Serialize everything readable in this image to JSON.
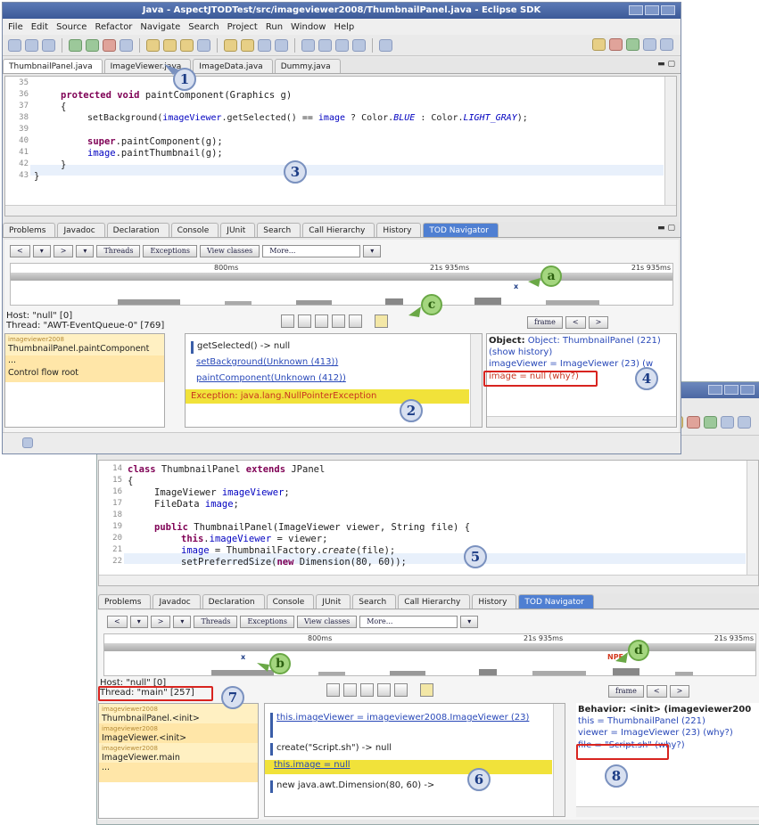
{
  "window1": {
    "title": "Java - AspectJTODTest/src/imageviewer2008/ThumbnailPanel.java - Eclipse SDK",
    "menu": [
      "File",
      "Edit",
      "Source",
      "Refactor",
      "Navigate",
      "Search",
      "Project",
      "Run",
      "Window",
      "Help"
    ],
    "editor_tabs": [
      "ThumbnailPanel.java",
      "ImageViewer.java",
      "ImageData.java",
      "Dummy.java"
    ],
    "code_lines": [
      {
        "n": "35",
        "t": ""
      },
      {
        "n": "36",
        "t": "protected void paintComponent(Graphics g)"
      },
      {
        "n": "37",
        "t": "{"
      },
      {
        "n": "38",
        "t": "setBackground(imageViewer.getSelected() == image ? Color.BLUE : Color.LIGHT_GRAY);"
      },
      {
        "n": "39",
        "t": ""
      },
      {
        "n": "40",
        "t": "super.paintComponent(g);"
      },
      {
        "n": "41",
        "t": "image.paintThumbnail(g);"
      },
      {
        "n": "42",
        "t": "}"
      },
      {
        "n": "43",
        "t": "}"
      }
    ],
    "view_tabs": [
      "Problems",
      "Javadoc",
      "Declaration",
      "Console",
      "JUnit",
      "Search",
      "Call Hierarchy",
      "History",
      "TOD Navigator"
    ],
    "nav_buttons": [
      "Threads",
      "Exceptions",
      "View classes",
      "More..."
    ],
    "timeline_labels": [
      "800ms",
      "21s 935ms",
      "21s 935ms"
    ],
    "host": "Host: \"null\" [0]",
    "thread": "Thread: \"AWT-EventQueue-0\" [769]",
    "stack": [
      {
        "pkg": "imageviewer2008",
        "label": "ThumbnailPanel.paintComponent"
      },
      {
        "pkg": "",
        "label": "..."
      },
      {
        "pkg": "",
        "label": "Control flow root"
      }
    ],
    "events": [
      "getSelected() -> null",
      "setBackground(Unknown (413))",
      "paintComponent(Unknown (412))",
      "Exception: java.lang.NullPointerException"
    ],
    "frame_label": "frame",
    "object": {
      "header": "Object: ThumbnailPanel (221)",
      "show_history": "(show history)",
      "row1": "imageViewer = ImageViewer (23) (w",
      "row2": "image = null (why?)"
    }
  },
  "window2": {
    "code_lines": [
      {
        "n": "14",
        "t": "class ThumbnailPanel extends JPanel"
      },
      {
        "n": "15",
        "t": "{"
      },
      {
        "n": "16",
        "t": "ImageViewer imageViewer;"
      },
      {
        "n": "17",
        "t": "FileData image;"
      },
      {
        "n": "18",
        "t": ""
      },
      {
        "n": "19",
        "t": "public ThumbnailPanel(ImageViewer viewer, String file) {"
      },
      {
        "n": "20",
        "t": "this.imageViewer = viewer;"
      },
      {
        "n": "21",
        "t": "image = ThumbnailFactory.create(file);"
      },
      {
        "n": "22",
        "t": "setPreferredSize(new Dimension(80, 60));"
      }
    ],
    "view_tabs": [
      "Problems",
      "Javadoc",
      "Declaration",
      "Console",
      "JUnit",
      "Search",
      "Call Hierarchy",
      "History",
      "TOD Navigator"
    ],
    "nav_buttons": [
      "Threads",
      "Exceptions",
      "View classes",
      "More..."
    ],
    "timeline_labels": [
      "800ms",
      "21s 935ms",
      "21s 935ms"
    ],
    "npe_label": "NPE",
    "host": "Host: \"null\" [0]",
    "thread": "Thread: \"main\" [257]",
    "stack": [
      {
        "pkg": "imageviewer2008",
        "label": "ThumbnailPanel.<init>"
      },
      {
        "pkg": "imageviewer2008",
        "label": "ImageViewer.<init>"
      },
      {
        "pkg": "imageviewer2008",
        "label": "ImageViewer.main"
      },
      {
        "pkg": "",
        "label": "..."
      }
    ],
    "events": [
      "this.imageViewer = imageviewer2008.ImageViewer (23)",
      "create(\"Script.sh\") -> null",
      "this.image = null",
      "new java.awt.Dimension(80, 60) ->"
    ],
    "frame_label": "frame",
    "behavior": {
      "header": "Behavior: <init> (imageviewer200",
      "row1": "this = ThumbnailPanel (221)",
      "row2": "viewer = ImageViewer (23) (why?)",
      "row3": "file = \"Script.sh\" (why?)"
    }
  },
  "callouts": [
    "1",
    "2",
    "3",
    "4",
    "5",
    "6",
    "7",
    "8"
  ],
  "letters": [
    "a",
    "b",
    "c",
    "d"
  ]
}
